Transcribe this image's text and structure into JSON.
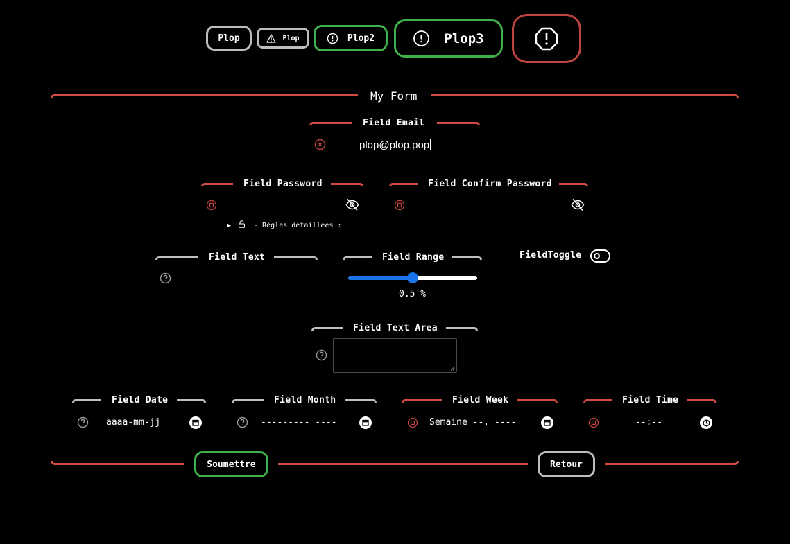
{
  "toolbar": {
    "plop1": "Plop",
    "plop_warning": "Plop",
    "plop2": "Plop2",
    "plop3": "Plop3"
  },
  "form": {
    "title": "My Form",
    "email": {
      "legend": "Field Email",
      "value": "plop@plop.pop"
    },
    "password": {
      "legend": "Field Password",
      "rules_summary": "- Règles détaillées :"
    },
    "confirm_password": {
      "legend": "Field Confirm Password"
    },
    "text": {
      "legend": "Field Text"
    },
    "range": {
      "legend": "Field Range",
      "value_label": "0.5 %",
      "value": 0.5,
      "min": 0,
      "max": 1
    },
    "toggle": {
      "label": "FieldToggle"
    },
    "textarea": {
      "legend": "Field Text Area"
    },
    "date": {
      "legend": "Field Date",
      "placeholder": "aaaa-mm-jj"
    },
    "month": {
      "legend": "Field Month",
      "placeholder": "--------- ----"
    },
    "week": {
      "legend": "Field Week",
      "placeholder": "Semaine --, ----"
    },
    "time": {
      "legend": "Field Time",
      "placeholder": "--:--"
    },
    "submit_label": "Soumettre",
    "back_label": "Retour"
  },
  "colors": {
    "accent_red": "#d24c45",
    "accent_green": "#3fb04a",
    "neutral_gray": "#bfbfbf",
    "range_blue": "#1a73e8"
  },
  "icons": {
    "warning": "warning-triangle-icon",
    "info": "exclamation-circle-icon",
    "alert": "octagon-alert-icon",
    "error": "x-circle-icon",
    "help": "question-circle-icon",
    "invalid": "square-circle-icon",
    "eye_off": "eye-off-icon",
    "lock": "lock-icon",
    "calendar": "calendar-icon",
    "clock": "clock-icon"
  }
}
